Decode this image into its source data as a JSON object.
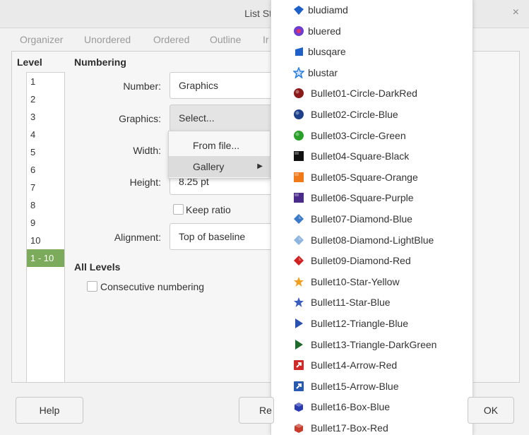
{
  "window": {
    "title": "List Style",
    "close_glyph": "×"
  },
  "tabs": [
    "Organizer",
    "Unordered",
    "Ordered",
    "Outline",
    "Ir"
  ],
  "level": {
    "title": "Level",
    "items": [
      "1",
      "2",
      "3",
      "4",
      "5",
      "6",
      "7",
      "8",
      "9",
      "10",
      "1 - 10"
    ],
    "selected": "1 - 10"
  },
  "numbering": {
    "title": "Numbering",
    "number_label": "Number:",
    "number_value": "Graphics",
    "graphics_label": "Graphics:",
    "graphics_button": "Select...",
    "width_label": "Width:",
    "height_label": "Height:",
    "height_value": "8.25 pt",
    "keep_ratio": "Keep ratio",
    "alignment_label": "Alignment:",
    "alignment_value": "Top of baseline"
  },
  "all_levels": {
    "title": "All Levels",
    "consecutive": "Consecutive numbering"
  },
  "context_menu": {
    "from_file": "From file...",
    "gallery": "Gallery",
    "submenu_arrow": "▶"
  },
  "gallery": [
    {
      "label": "bludiamd",
      "icon": "blue-diamond-icon",
      "color": "#1f5fc8"
    },
    {
      "label": "bluered",
      "icon": "blue-red-circle-icon",
      "color": "#6a3fd0"
    },
    {
      "label": "blusqare",
      "icon": "blue-square-icon",
      "color": "#1f5fc8"
    },
    {
      "label": "blustar",
      "icon": "blue-star-icon",
      "color": "#2a7de0"
    },
    {
      "label": "Bullet01-Circle-DarkRed",
      "icon": "circle-darkred-icon",
      "color": "#8b1a1a"
    },
    {
      "label": "Bullet02-Circle-Blue",
      "icon": "circle-blue-icon",
      "color": "#1e3f8a"
    },
    {
      "label": "Bullet03-Circle-Green",
      "icon": "circle-green-icon",
      "color": "#2aa02a"
    },
    {
      "label": "Bullet04-Square-Black",
      "icon": "square-black-icon",
      "color": "#111111"
    },
    {
      "label": "Bullet05-Square-Orange",
      "icon": "square-orange-icon",
      "color": "#f07a1a"
    },
    {
      "label": "Bullet06-Square-Purple",
      "icon": "square-purple-icon",
      "color": "#4a2a8a"
    },
    {
      "label": "Bullet07-Diamond-Blue",
      "icon": "diamond-blue-icon",
      "color": "#3a78c8"
    },
    {
      "label": "Bullet08-Diamond-LightBlue",
      "icon": "diamond-lightblue-icon",
      "color": "#8fb4e0"
    },
    {
      "label": "Bullet09-Diamond-Red",
      "icon": "diamond-red-icon",
      "color": "#d02020"
    },
    {
      "label": "Bullet10-Star-Yellow",
      "icon": "star-yellow-icon",
      "color": "#f0a020"
    },
    {
      "label": "Bullet11-Star-Blue",
      "icon": "star-blue-icon",
      "color": "#3a5ec0"
    },
    {
      "label": "Bullet12-Triangle-Blue",
      "icon": "triangle-blue-icon",
      "color": "#2a50b0"
    },
    {
      "label": "Bullet13-Triangle-DarkGreen",
      "icon": "triangle-darkgreen-icon",
      "color": "#1e6a2a"
    },
    {
      "label": "Bullet14-Arrow-Red",
      "icon": "arrow-red-icon",
      "color": "#d02a2a"
    },
    {
      "label": "Bullet15-Arrow-Blue",
      "icon": "arrow-blue-icon",
      "color": "#2a5ab0"
    },
    {
      "label": "Bullet16-Box-Blue",
      "icon": "box-blue-icon",
      "color": "#2a3ab0"
    },
    {
      "label": "Bullet17-Box-Red",
      "icon": "box-red-icon",
      "color": "#c83a2a"
    }
  ],
  "footer": {
    "help": "Help",
    "reset": "Re",
    "ok": "OK"
  }
}
